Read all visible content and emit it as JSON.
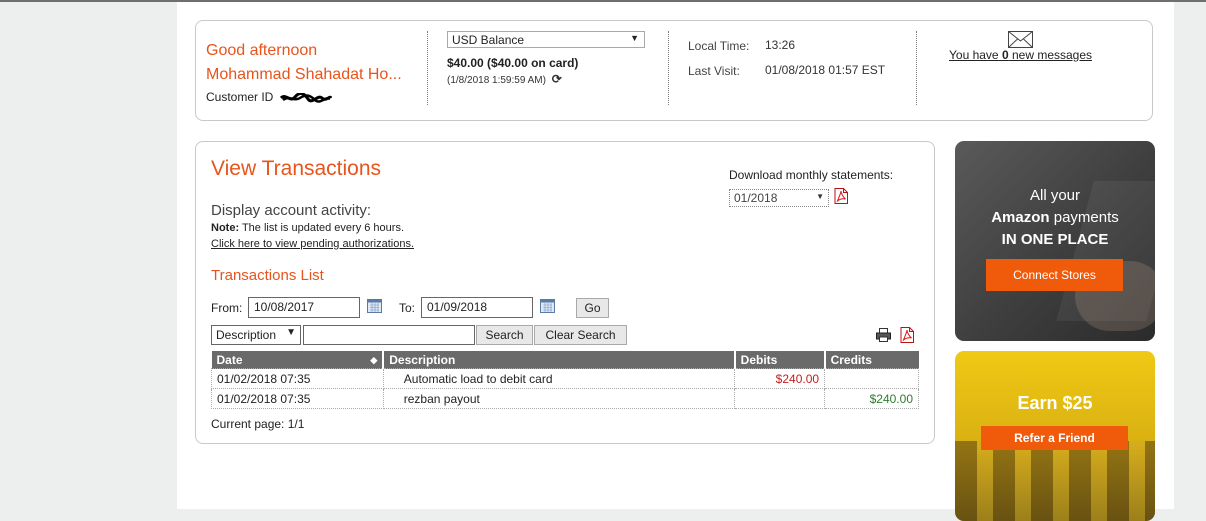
{
  "header": {
    "greeting_line1": "Good afternoon",
    "greeting_line2": "Mohammad Shahadat Ho...",
    "customer_id_label": "Customer ID",
    "balance_select": "USD Balance",
    "balance_amount": "$40.00 ($40.00 on card)",
    "balance_time": "(1/8/2018 1:59:59 AM)",
    "local_time_label": "Local Time:",
    "local_time_value": "13:26",
    "last_visit_label": "Last Visit:",
    "last_visit_value": "01/08/2018 01:57 EST",
    "messages_prefix": "You have ",
    "messages_count": "0",
    "messages_suffix": " new messages"
  },
  "transactions": {
    "title": "View Transactions",
    "download_label": "Download monthly statements:",
    "statement_month": "01/2018",
    "activity_title": "Display account activity:",
    "note_label": "Note:",
    "note_text": " The list is updated every 6 hours.",
    "pending_link": "Click here to view pending authorizations.",
    "list_title": "Transactions List",
    "from_label": "From:",
    "from_value": "10/08/2017",
    "to_label": "To:",
    "to_value": "01/09/2018",
    "go_label": "Go",
    "search_field": "Description",
    "search_value": "",
    "search_label": "Search",
    "clear_search_label": "Clear Search",
    "columns": [
      "Date",
      "Description",
      "Debits",
      "Credits"
    ],
    "rows": [
      {
        "date": "01/02/2018 07:35",
        "description": "Automatic load to debit card",
        "debit": "$240.00",
        "credit": ""
      },
      {
        "date": "01/02/2018 07:35",
        "description": "rezban payout",
        "debit": "",
        "credit": "$240.00"
      }
    ],
    "page_info": "Current page: 1/1"
  },
  "ads": {
    "amazon_line1": "All your",
    "amazon_brand": "Amazon",
    "amazon_line2_rest": " payments",
    "amazon_line3": "IN ONE PLACE",
    "connect_label": "Connect Stores",
    "earn_text": "Earn $25",
    "refer_label": "Refer a Friend"
  },
  "colors": {
    "accent": "#e8541c",
    "button_orange": "#f05a0b",
    "debit": "#c21f1f",
    "credit": "#2f7b2f",
    "table_header": "#6a6a6a"
  },
  "icons": [
    "envelope-icon",
    "refresh-icon",
    "pdf-icon",
    "calendar-icon",
    "print-icon",
    "sort-icon",
    "chevron-down-icon"
  ]
}
